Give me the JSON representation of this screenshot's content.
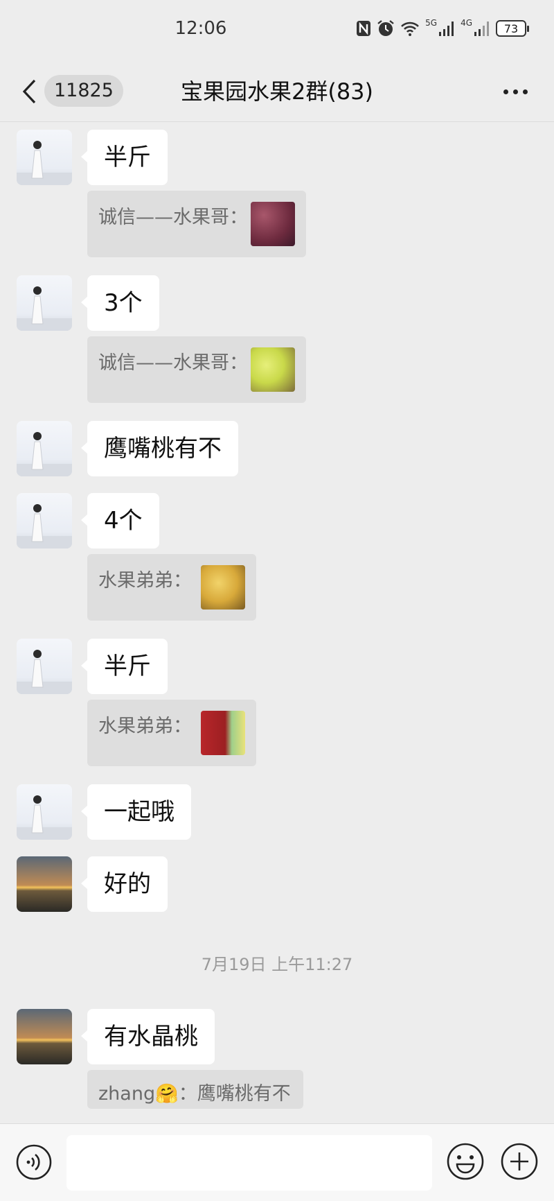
{
  "status_bar": {
    "time": "12:06",
    "signal_1_label": "5G",
    "signal_2_label": "4G",
    "battery_level": "73",
    "icons": [
      "nfc-icon",
      "alarm-icon",
      "wifi-icon",
      "signal-5g-icon",
      "signal-4g-icon",
      "battery-icon"
    ]
  },
  "nav": {
    "back_icon": "chevron-left-icon",
    "unread_count": "11825",
    "title": "宝果园水果2群(83)",
    "more_icon": "more-dots-icon"
  },
  "messages": [
    {
      "sender": "girl",
      "text": "半斤",
      "quote": "诚信——水果哥：",
      "quote_image": "grapes"
    },
    {
      "sender": "girl",
      "text": "3个",
      "quote": "诚信——水果哥：",
      "quote_image": "green-apples"
    },
    {
      "sender": "girl",
      "text": "鹰嘴桃有不"
    },
    {
      "sender": "girl",
      "text": "4个",
      "quote": "水果弟弟：",
      "quote_image": "yellow-fruit"
    },
    {
      "sender": "girl",
      "text": "半斤",
      "quote": "水果弟弟：",
      "quote_image": "cherries"
    },
    {
      "sender": "girl",
      "text": "一起哦"
    },
    {
      "sender": "sunset",
      "text": "好的"
    },
    {
      "type": "timestamp",
      "text": "7月19日 上午11:27"
    },
    {
      "sender": "sunset",
      "text": "有水晶桃",
      "quote": "zhang🤗：鹰嘴桃有不"
    }
  ],
  "input_bar": {
    "voice_icon": "voice-icon",
    "input_value": "",
    "emoji_icon": "emoji-icon",
    "plus_icon": "plus-icon"
  }
}
